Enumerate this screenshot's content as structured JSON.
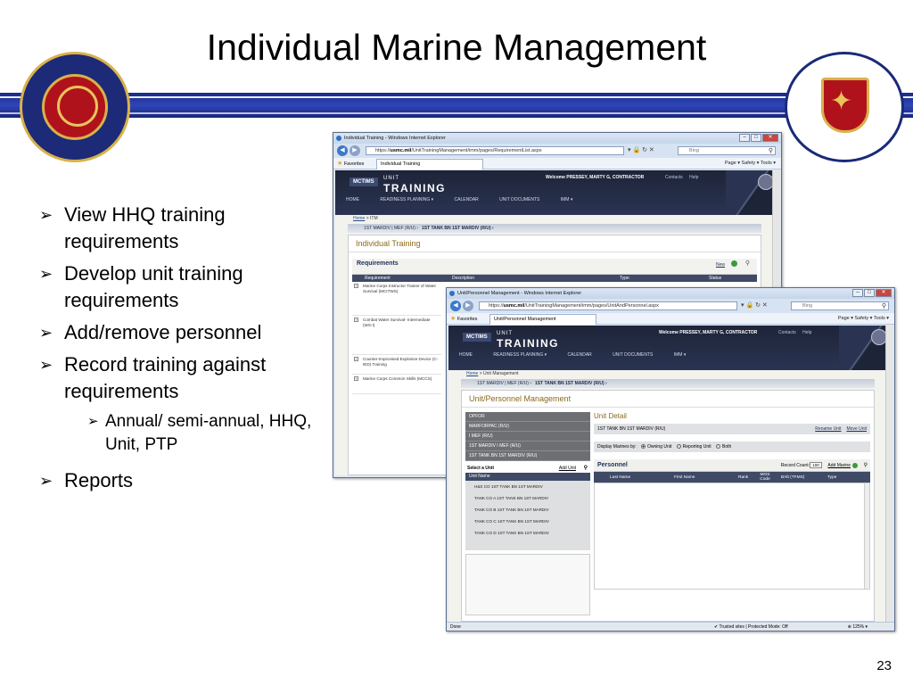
{
  "slide": {
    "title": "Individual Marine Management",
    "page_number": "23",
    "bullets": [
      "View HHQ training requirements",
      "Develop unit training requirements",
      "Add/remove personnel",
      "Record training against requirements"
    ],
    "sub_bullet": "Annual/ semi-annual, HHQ, Unit, PTP",
    "last_bullet": "Reports"
  },
  "colors": {
    "band": "#1f2e98",
    "header": "#1e2438",
    "accent": "#8a6a1a",
    "table_header": "#3e4a66"
  },
  "window1": {
    "title": "Individual Training - Windows Internet Explorer",
    "url_prefix": "https://",
    "url_host": "usmc.mil",
    "url_path": "/UnitTrainingManagement/imm/pages/RequirementList.aspx",
    "search_placeholder": "Bing",
    "favorites": "Favorites",
    "tab": "Individual Training",
    "tools": "Page ▾  Safety ▾  Tools ▾",
    "app": {
      "logo": "MCTIMS",
      "unit": "UNIT",
      "training": "TRAINING",
      "welcome": "Welcome PRESSEY, MARTY G, CONTRACTOR",
      "links": "Contacts  Help",
      "menu": [
        "HOME",
        "READINESS PLANNING ▾",
        "CALENDAR",
        "UNIT DOCUMENTS",
        "IMM ▾"
      ]
    },
    "breadcrumb_home": "Home",
    "breadcrumb_rest": " > ITM",
    "unit_path": "1ST MARDIV | MEF (R/U) ›",
    "unit_current": "1ST TANK BN 1ST MARDIV (R/U) ›",
    "page_title": "Individual Training",
    "requirements": {
      "title": "Requirements",
      "new": "New",
      "columns": [
        "Requirement",
        "Description",
        "Type",
        "Status"
      ],
      "rows": [
        "Marine Corps Instructor Trainer of Water Survival (MCITWS)",
        "Combat Water Survival- Intermediate (WS-I)",
        "Counter-Improvised Explosive Device (C-IED) Training",
        "Marine Corps Common Skills (MCCS)"
      ]
    }
  },
  "window2": {
    "title": "Unit/Personnel Management - Windows Internet Explorer",
    "url_prefix": "https://",
    "url_host": "usmc.mil",
    "url_path": "/UnitTrainingManagement/imm/pages/UnitAndPersonnel.aspx",
    "search_placeholder": "Bing",
    "favorites": "Favorites",
    "tab": "Unit/Personnel Management",
    "tools": "Page ▾  Safety ▾  Tools ▾",
    "app": {
      "logo": "MCTIMS",
      "unit": "UNIT",
      "training": "TRAINING",
      "welcome": "Welcome PRESSEY, MARTY G, CONTRACTOR",
      "links": "Contacts  Help",
      "menu": [
        "HOME",
        "READINESS PLANNING ▾",
        "CALENDAR",
        "UNIT DOCUMENTS",
        "IMM ▾"
      ]
    },
    "breadcrumb_home": "Home",
    "breadcrumb_rest": " > Unit Management",
    "unit_path": "1ST MARDIV | MEF (R/U) ›",
    "unit_current": "1ST TANK BN 1ST MARDIV (R/U) ›",
    "page_title": "Unit/Personnel Management",
    "unit_hierarchy": [
      "OPFOR",
      "MARFORPAC (R/U)",
      "I MEF (R/U)",
      "1ST MARDIV I MEF (R/U)",
      "1ST TANK BN 1ST MARDIV (R/U)"
    ],
    "select_unit": "Select a Unit",
    "add_unit": "Add Unit",
    "unit_name_col": "Unit Name",
    "sub_units": [
      "H&S CO 1ST TANK BN 1ST MARDIV",
      "TANK CO A 1ST TANK BN 1ST MARDIV",
      "TANK CO B 1ST TANK BN 1ST MARDIV",
      "TANK CO C 1ST TANK BN 1ST MARDIV",
      "TANK CO D 1ST TANK BN 1ST MARDIV"
    ],
    "detail": {
      "title": "Unit Detail",
      "unit": "1ST TANK BN 1ST MARDIV (R/U)",
      "rename": "Rename Unit",
      "move": "Move Unit",
      "display_label": "Display Marines by:",
      "options": [
        "Owning Unit",
        "Reporting Unit",
        "Both"
      ],
      "personnel": "Personnel",
      "record_count_label": "Record Count:",
      "record_count": "100",
      "add_marine": "Add Marine",
      "columns": [
        "Last Name",
        "First Name",
        "Rank",
        "MOS Code",
        "BAlt (TFMS)",
        "Type"
      ]
    },
    "status": {
      "left": "Done",
      "zone": "✔ Trusted sites | Protected Mode: Off",
      "zoom": "⊕ 125% ▾"
    }
  }
}
